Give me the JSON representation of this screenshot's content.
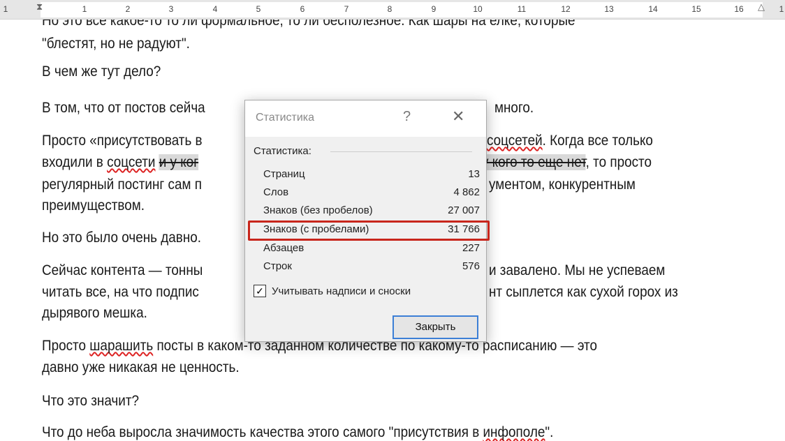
{
  "ruler": {
    "numbers": [
      "1",
      "1",
      "2",
      "3",
      "4",
      "5",
      "6",
      "7",
      "8",
      "9",
      "10",
      "11",
      "12",
      "13",
      "14",
      "15",
      "16",
      "1"
    ]
  },
  "document": {
    "lines": [
      "Но это все какое-то то ли формальное, то ли бесполезное. Как шары на елке, которые",
      "\"блестят, но не радуют\".",
      "В чем же тут дело?",
      "В том, что от постов сейча",
      "много.",
      "Просто «присутствовать в",
      "соцсетей",
      ". Когда все только",
      "входили в ",
      "соцсети",
      "и у ког",
      "у кого то еще нет",
      ", то просто",
      "регулярный постинг сам п",
      "ументом, конкурентным",
      "преимуществом.",
      "Но это было очень давно.",
      "Сейчас контента — тонны",
      "и завалено. Мы не успеваем",
      "читать все, на что подпис",
      "нт сыплется как сухой горох из",
      "дырявого мешка.",
      "Просто ",
      "шарашить",
      " посты в каком-то заданном количестве по какому-то расписанию — это",
      "давно уже никакая не ценность.",
      "Что это значит?",
      "Что до неба выросла значимость качества этого самого \"присутствия в ",
      "инфополе",
      "\"."
    ]
  },
  "dialog": {
    "title": "Статистика",
    "help": "?",
    "close": "✕",
    "group_label": "Статистика:",
    "rows": [
      {
        "label": "Страниц",
        "value": "13"
      },
      {
        "label": "Слов",
        "value": "4 862"
      },
      {
        "label": "Знаков (без пробелов)",
        "value": "27 007"
      },
      {
        "label": "Знаков (с пробелами)",
        "value": "31 766"
      },
      {
        "label": "Абзацев",
        "value": "227"
      },
      {
        "label": "Строк",
        "value": "576"
      }
    ],
    "checkbox_label": "Учитывать надписи и сноски",
    "checkbox_checked": true,
    "checkmark": "✓",
    "close_button": "Закрыть",
    "highlight_color": "#c8261c"
  }
}
